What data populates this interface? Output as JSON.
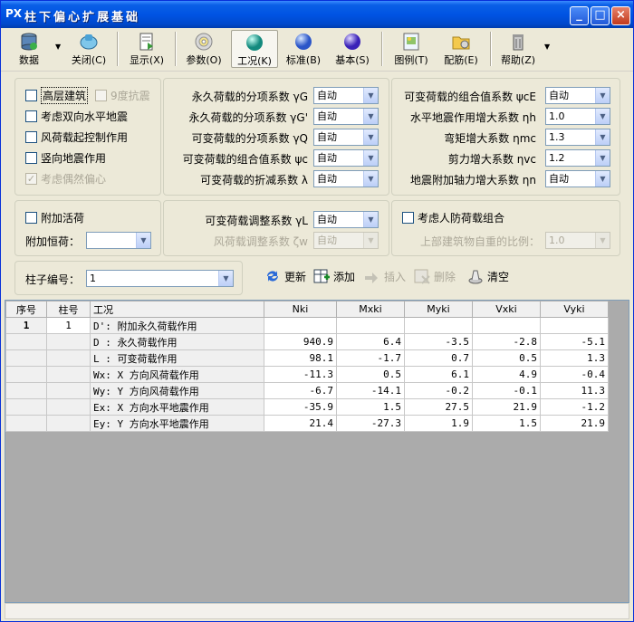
{
  "window": {
    "app_icon": "PX",
    "title": "柱下偏心扩展基础",
    "minimize": "_",
    "maximize": "□",
    "close": "×"
  },
  "toolbar": {
    "items": [
      {
        "label": "数据",
        "icon": "database-icon"
      },
      {
        "label": "关闭(C)",
        "icon": "close-tool-icon"
      },
      {
        "label": "显示(X)",
        "icon": "display-icon"
      },
      {
        "label": "参数(O)",
        "icon": "cd-disc-icon"
      },
      {
        "label": "工况(K)",
        "icon": "teal-sphere-icon"
      },
      {
        "label": "标准(B)",
        "icon": "blue-sphere-icon"
      },
      {
        "label": "基本(S)",
        "icon": "purple-sphere-icon"
      },
      {
        "label": "图例(T)",
        "icon": "image-icon"
      },
      {
        "label": "配筋(E)",
        "icon": "folder-gear-icon"
      },
      {
        "label": "帮助(Z)",
        "icon": "help-trash-icon"
      }
    ]
  },
  "options": {
    "high_building": "高层建筑",
    "nine_degree": "9度抗震",
    "bidirectional": "考虑双向水平地震",
    "wind_control": "风荷载起控制作用",
    "vertical_quake": "竖向地震作用",
    "accidental": "考虑偶然偏心"
  },
  "factors_mid": [
    {
      "label": "永久荷载的分项系数 γG",
      "value": "自动"
    },
    {
      "label": "永久荷载的分项系数 γG'",
      "value": "自动"
    },
    {
      "label": "可变荷载的分项系数 γQ",
      "value": "自动"
    },
    {
      "label": "可变荷载的组合值系数 ψc",
      "value": "自动"
    },
    {
      "label": "可变荷载的折减系数 λ",
      "value": "自动"
    }
  ],
  "factors_right": [
    {
      "label": "可变荷载的组合值系数 ψcE",
      "value": "自动"
    },
    {
      "label": "水平地震作用增大系数 ηh",
      "value": "1.0"
    },
    {
      "label": "弯矩增大系数 ηmc",
      "value": "1.3"
    },
    {
      "label": "剪力增大系数 ηvc",
      "value": "1.2"
    },
    {
      "label": "地震附加轴力增大系数 ηn",
      "value": "自动"
    }
  ],
  "live_load": {
    "checkbox": "附加活荷",
    "constant_label": "附加恒荷",
    "constant_value": ""
  },
  "adjust": {
    "variable_label": "可变荷载调整系数 γL",
    "variable_value": "自动",
    "wind_label": "风荷载调整系数 ζw",
    "wind_value": "自动"
  },
  "civil_defense": {
    "checkbox": "考虑人防荷载组合",
    "ratio_label": "上部建筑物自重的比例",
    "ratio_value": "1.0"
  },
  "column_select": {
    "label": "柱子编号",
    "value": "1"
  },
  "actions": {
    "update": "更新",
    "add": "添加",
    "insert": "插入",
    "delete": "删除",
    "clear": "清空"
  },
  "grid": {
    "headers": [
      "序号",
      "柱号",
      "工况",
      "Nki",
      "Mxki",
      "Myki",
      "Vxki",
      "Vyki"
    ],
    "rows": [
      {
        "idx": "1",
        "col": "1",
        "case": "D': 附加永久荷载作用",
        "values": [
          "",
          "",
          "",
          "",
          ""
        ]
      },
      {
        "idx": "",
        "col": "",
        "case": "D : 永久荷载作用",
        "values": [
          "940.9",
          "6.4",
          "-3.5",
          "-2.8",
          "-5.1"
        ]
      },
      {
        "idx": "",
        "col": "",
        "case": "L : 可变荷载作用",
        "values": [
          "98.1",
          "-1.7",
          "0.7",
          "0.5",
          "1.3"
        ]
      },
      {
        "idx": "",
        "col": "",
        "case": "Wx: X 方向风荷载作用",
        "values": [
          "-11.3",
          "0.5",
          "6.1",
          "4.9",
          "-0.4"
        ]
      },
      {
        "idx": "",
        "col": "",
        "case": "Wy: Y 方向风荷载作用",
        "values": [
          "-6.7",
          "-14.1",
          "-0.2",
          "-0.1",
          "11.3"
        ]
      },
      {
        "idx": "",
        "col": "",
        "case": "Ex: X 方向水平地震作用",
        "values": [
          "-35.9",
          "1.5",
          "27.5",
          "21.9",
          "-1.2"
        ]
      },
      {
        "idx": "",
        "col": "",
        "case": "Ey: Y 方向水平地震作用",
        "values": [
          "21.4",
          "-27.3",
          "1.9",
          "1.5",
          "21.9"
        ]
      }
    ]
  }
}
